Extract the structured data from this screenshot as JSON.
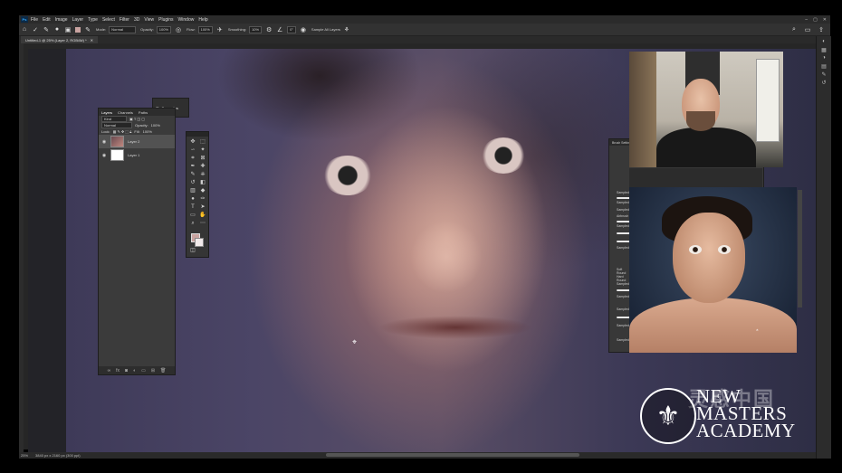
{
  "app": {
    "menu": [
      "File",
      "Edit",
      "Image",
      "Layer",
      "Type",
      "Select",
      "Filter",
      "3D",
      "View",
      "Plugins",
      "Window",
      "Help"
    ]
  },
  "options_bar": {
    "mode_label": "Mode:",
    "mode_value": "Normal",
    "opacity_label": "Opacity:",
    "opacity_value": "100%",
    "flow_label": "Flow:",
    "flow_value": "100%",
    "smoothing_label": "Smoothing:",
    "smoothing_value": "10%",
    "angle_value": "0°",
    "sample_label": "Sample All Layers"
  },
  "document": {
    "tab_label": "Untitled-1 @ 25% (Layer 2, RGB/8#) *",
    "zoom": "25%",
    "doc_info": "3840 px x 2160 px (300 ppi)"
  },
  "layers_panel": {
    "tabs": [
      "Layers",
      "Channels",
      "Paths"
    ],
    "filter_label": "Kind",
    "blend_mode": "Normal",
    "opacity_label": "Opacity:",
    "opacity_value": "100%",
    "lock_label": "Lock:",
    "fill_label": "Fill:",
    "fill_value": "100%",
    "layers": [
      {
        "name": "Layer 2",
        "selected": true
      },
      {
        "name": "Layer 1",
        "selected": false
      }
    ]
  },
  "properties_panel": {
    "title": "Properties"
  },
  "brush_panel": {
    "title": "Brush Settings",
    "items": [
      "Sampled",
      "Sampled",
      "Sampled",
      "Airbrush",
      "Sampled",
      "Sampled",
      "Soft Round",
      "Hard Round",
      "Sampled",
      "Sampled",
      "Sampled",
      "Sampled",
      "Sampled"
    ]
  },
  "watermark": {
    "brand_line1": "NEW",
    "brand_line2": "MASTERS",
    "brand_line3": "ACADEMY",
    "cn_text": "灵感中国"
  },
  "colors": {
    "foreground": "#c9a3a0",
    "background": "#f2eaea",
    "ui_dark": "#2b2b2b"
  }
}
